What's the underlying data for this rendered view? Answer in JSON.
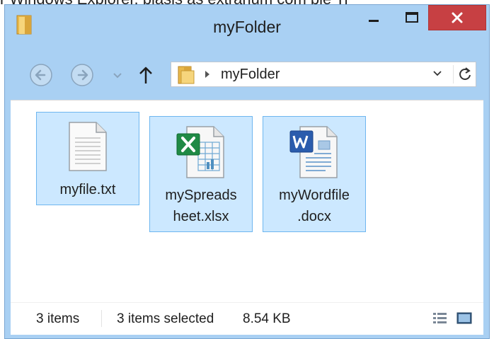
{
  "caption_partial": "r Windows Explorer, blasis as extranum com pie Ti",
  "window": {
    "title": "myFolder",
    "buttons": {
      "minimize": "minimize",
      "maximize": "maximize",
      "close": "close"
    }
  },
  "toolbar": {
    "back": "back",
    "forward": "forward",
    "recent": "recent-locations",
    "up": "up"
  },
  "address": {
    "path": "myFolder"
  },
  "files": [
    {
      "name": "myfile.txt",
      "line1": "myfile.txt",
      "line2": "",
      "type": "text",
      "icon": "text-file-icon"
    },
    {
      "name": "mySpreadsheet.xlsx",
      "line1": "mySpreads",
      "line2": "heet.xlsx",
      "type": "excel",
      "icon": "excel-file-icon"
    },
    {
      "name": "myWordfile.docx",
      "line1": "myWordfile",
      "line2": ".docx",
      "type": "word",
      "icon": "word-file-icon"
    }
  ],
  "status": {
    "item_count": "3 items",
    "selection": "3 items selected",
    "size": "8.54 KB"
  },
  "colors": {
    "frame": "#a9d0f3",
    "close_button": "#c74043",
    "selection_fill": "#cce8ff",
    "selection_border": "#6eb6ef"
  }
}
